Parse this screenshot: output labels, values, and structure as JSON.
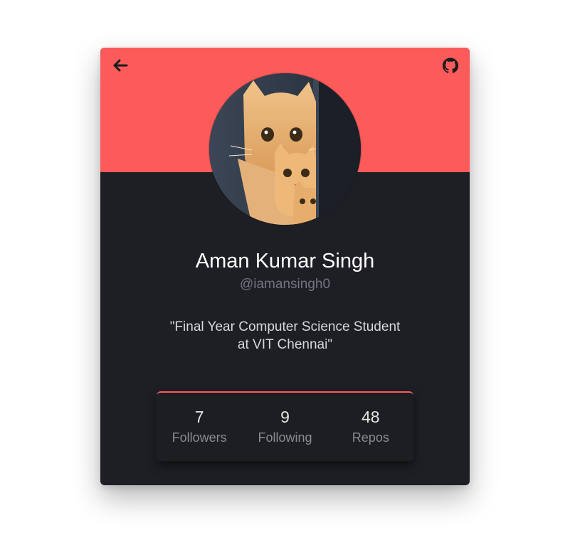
{
  "profile": {
    "name": "Aman Kumar Singh",
    "handle": "@iamansingh0",
    "bio_line1": "\"Final Year Computer Science Student",
    "bio_line2": "at VIT Chennai\""
  },
  "stats": [
    {
      "value": "7",
      "label": "Followers"
    },
    {
      "value": "9",
      "label": "Following"
    },
    {
      "value": "48",
      "label": "Repos"
    }
  ],
  "icons": {
    "back": "arrow-left-icon",
    "github": "github-icon"
  },
  "colors": {
    "accent": "#fd5a5a",
    "card_bg": "#1e1f24",
    "stats_bg": "#1c1e22"
  }
}
